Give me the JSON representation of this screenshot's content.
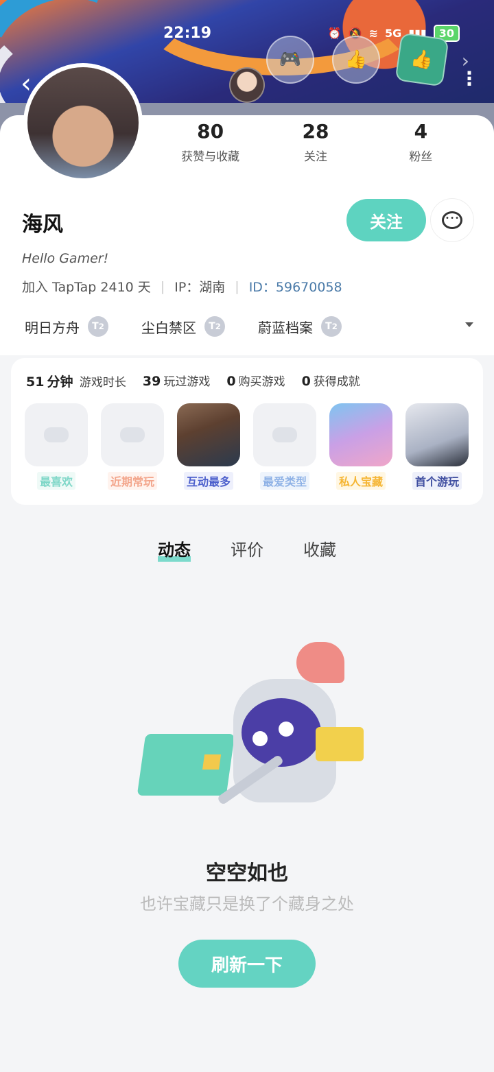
{
  "status_bar": {
    "time": "22:19",
    "battery": "30",
    "network": "5G"
  },
  "header": {
    "back_icon": "chevron-left-icon",
    "more_icon": "more-vertical-icon",
    "medals": [
      "controller-medal-icon",
      "thumbs-up-medal-icon",
      "thumbs-up-medal-green-icon"
    ]
  },
  "profile": {
    "stats": [
      {
        "num": "80",
        "label": "获赞与收藏"
      },
      {
        "num": "28",
        "label": "关注"
      },
      {
        "num": "4",
        "label": "粉丝"
      }
    ],
    "name": "海风",
    "follow_label": "关注",
    "bio": "Hello Gamer!",
    "join": "加入 TapTap 2410 天",
    "ip": "IP：湖南",
    "id_label": "ID：",
    "id_value": "59670058"
  },
  "tags": [
    {
      "label": "明日方舟",
      "badge": "2"
    },
    {
      "label": "尘白禁区",
      "badge": "2"
    },
    {
      "label": "蔚蓝档案",
      "badge": "2"
    }
  ],
  "game_stats": [
    {
      "num": "51",
      "unit": "分钟",
      "label": "游戏时长"
    },
    {
      "num": "39",
      "label": "玩过游戏"
    },
    {
      "num": "0",
      "label": "购买游戏"
    },
    {
      "num": "0",
      "label": "获得成就"
    }
  ],
  "game_tiles": [
    {
      "label": "最喜欢"
    },
    {
      "label": "近期常玩"
    },
    {
      "label": "互动最多"
    },
    {
      "label": "最爱类型"
    },
    {
      "label": "私人宝藏"
    },
    {
      "label": "首个游玩"
    }
  ],
  "tabs": [
    "动态",
    "评价",
    "收藏"
  ],
  "empty": {
    "title": "空空如也",
    "subtitle": "也许宝藏只是换了个藏身之处",
    "refresh_label": "刷新一下"
  },
  "colors": {
    "accent": "#5ed3c0",
    "id_link": "#4a7aa8"
  }
}
